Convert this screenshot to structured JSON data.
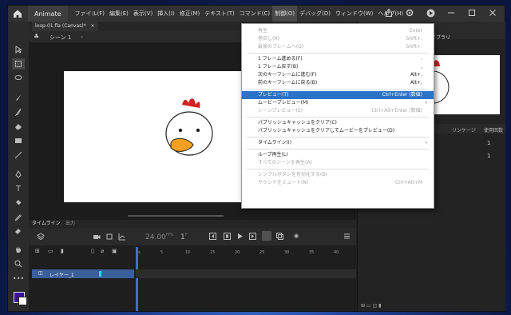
{
  "app": {
    "name": "Animate",
    "menu": [
      "ファイル(F)",
      "編集(E)",
      "表示(V)",
      "挿入(I)",
      "修正(M)",
      "テキスト(T)",
      "コマンド(C)",
      "制御(O)",
      "デバッグ(D)",
      "ウィンドウ(W)",
      "ヘルプ(H)"
    ],
    "active_menu_index": 7
  },
  "document": {
    "tab_label": "loop-01.fla (Canvas)*",
    "scene_label": "シーン 1"
  },
  "timeline": {
    "tab_timeline": "タイムライン",
    "tab_output": "出力",
    "fps": "24.00",
    "fps_unit": "FPS",
    "frame": "1",
    "frame_unit": "F",
    "layer_name": "レイヤー_1",
    "ruler": [
      "1s",
      "5",
      "10",
      "15",
      "20",
      "25",
      "30",
      "35",
      "40"
    ]
  },
  "right_panel": {
    "header_tab": "ライブラリ",
    "col_linkage": "リンケージ",
    "col_usage": "使用回数",
    "usage_values": [
      "1",
      "1"
    ]
  },
  "control_menu": {
    "items": [
      {
        "label": "再生",
        "shortcut": "Enter",
        "disabled": true
      },
      {
        "label": "巻戻し(R)",
        "shortcut": "Shift+,",
        "disabled": true
      },
      {
        "label": "最後のフレームへ(G)",
        "shortcut": "Shift+.",
        "disabled": true
      },
      {
        "sep": true
      },
      {
        "label": "1 フレーム進める(F)",
        "shortcut": ".",
        "disabled": false
      },
      {
        "label": "1 フレーム戻す(B)",
        "shortcut": ",",
        "disabled": false
      },
      {
        "label": "次のキーフレームに進む(F)",
        "shortcut": "Alt+.",
        "disabled": false
      },
      {
        "label": "前のキーフレームに戻る(B)",
        "shortcut": "Alt+,",
        "disabled": false
      },
      {
        "sep": true
      },
      {
        "label": "プレビュー(T)",
        "shortcut": "Ctrl+Enter (数値)",
        "disabled": false,
        "highlight": true
      },
      {
        "label": "ムービープレビュー(M)",
        "shortcut": "",
        "disabled": false,
        "submenu": true
      },
      {
        "label": "シーンプレビュー(S)",
        "shortcut": "Ctrl+Alt+Enter (数値)",
        "disabled": true
      },
      {
        "sep": true
      },
      {
        "label": "パブリッシュキャッシュをクリア(C)",
        "shortcut": "",
        "disabled": false
      },
      {
        "label": "パブリッシュキャッシュをクリアしてムービーをプレビュー(D)",
        "shortcut": "",
        "disabled": false
      },
      {
        "sep": true
      },
      {
        "label": "タイムライン(I)",
        "shortcut": "",
        "disabled": false,
        "submenu": true
      },
      {
        "sep": true
      },
      {
        "label": "ループ再生(L)",
        "shortcut": "",
        "disabled": false
      },
      {
        "label": "すべてのシーンを再生(A)",
        "shortcut": "",
        "disabled": true
      },
      {
        "sep": true
      },
      {
        "label": "シンプルボタンを有効化する(B)",
        "shortcut": "",
        "disabled": true
      },
      {
        "label": "サウンドをミュート(N)",
        "shortcut": "Ctrl+Alt+M",
        "disabled": true
      }
    ]
  },
  "colors": {
    "highlight": "#2a73c8",
    "menubar": "#323232",
    "stage": "#ffffff",
    "chicken_comb": "#d42020",
    "chicken_beak": "#f5a020"
  },
  "icons": [
    "home-icon",
    "share-icon",
    "settings-icon",
    "play-icon",
    "minimize-icon",
    "maximize-icon",
    "close-icon"
  ]
}
